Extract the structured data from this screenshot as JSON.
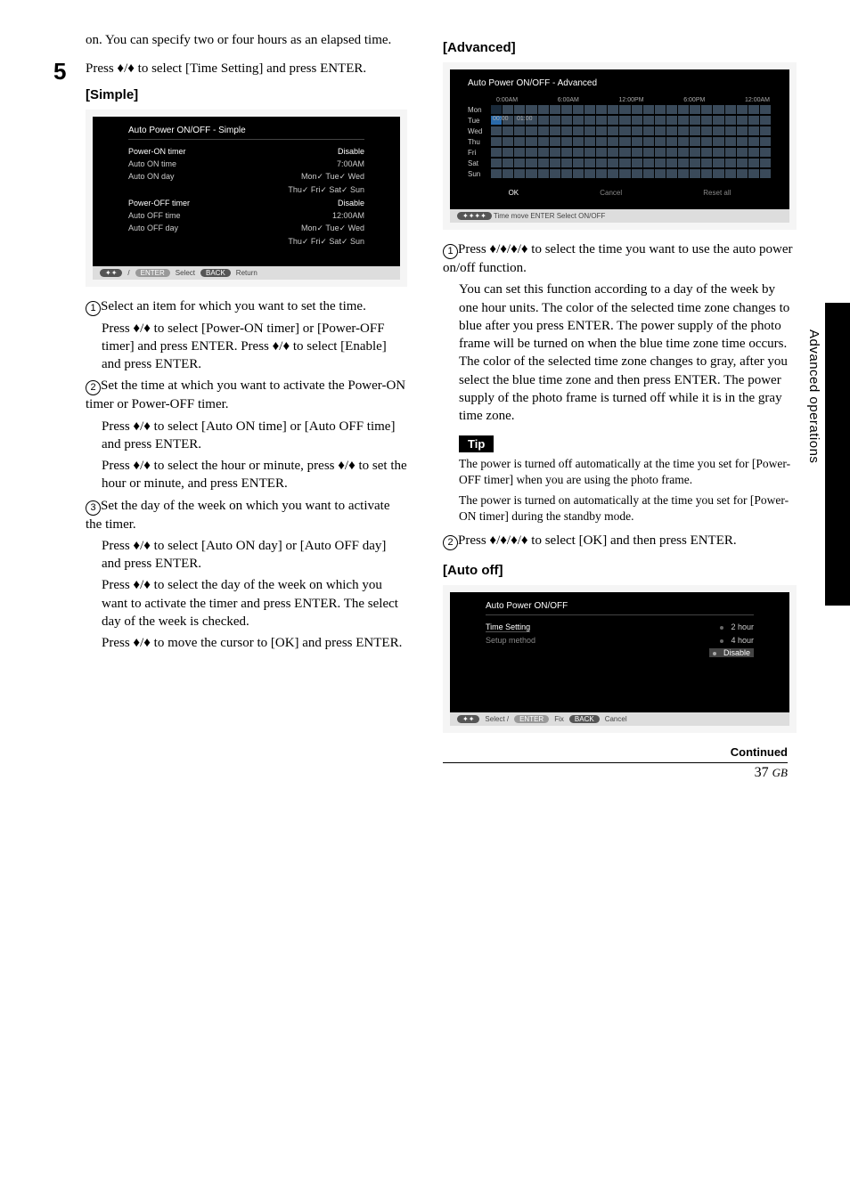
{
  "side_tab_label": "Advanced operations",
  "intro_text": "on. You can specify two or four hours as an elapsed time.",
  "step5": {
    "num": "5",
    "text": "Press ♦/♦ to select [Time Setting] and press ENTER."
  },
  "simple": {
    "heading": "[Simple]",
    "osd_title": "Auto Power ON/OFF - Simple",
    "rows": [
      {
        "l": "Power-ON timer",
        "r": "Disable",
        "white": true
      },
      {
        "l": "Auto ON time",
        "r": "7:00AM"
      },
      {
        "l": "Auto ON day",
        "r": "Mon✓ Tue✓ Wed"
      },
      {
        "l": "",
        "r": "Thu✓   Fri✓   Sat✓  Sun"
      },
      {
        "l": "Power-OFF timer",
        "r": "Disable",
        "white": true
      },
      {
        "l": "Auto OFF time",
        "r": "12:00AM"
      },
      {
        "l": "Auto OFF day",
        "r": "Mon✓ Tue✓ Wed"
      },
      {
        "l": "",
        "r": "Thu✓   Fri✓   Sat✓  Sun"
      }
    ],
    "footer": [
      "ENTER",
      "Select",
      "BACK",
      "Return"
    ],
    "step1_a": "Select an item for which you want to set the time.",
    "step1_b": "Press ♦/♦ to select [Power-ON timer] or [Power-OFF timer] and press ENTER. Press ♦/♦ to select [Enable] and press ENTER.",
    "step2_a": "Set the time at which you want to activate the Power-ON timer or Power-OFF timer.",
    "step2_b": "Press ♦/♦ to select [Auto ON time] or [Auto OFF time] and press ENTER.",
    "step2_c": "Press ♦/♦ to select the hour or minute, press ♦/♦ to set the hour or minute, and press ENTER.",
    "step3_a": "Set the day of the week on which you want to activate the timer.",
    "step3_b": "Press ♦/♦ to select [Auto ON day] or [Auto OFF day] and press ENTER.",
    "step3_c": "Press ♦/♦ to select the day of the week on which you want to activate the timer and press ENTER. The select day of the week is checked.",
    "step3_d": "Press ♦/♦ to move the cursor to [OK] and press ENTER."
  },
  "advanced": {
    "heading": "[Advanced]",
    "osd_title": "Auto Power ON/OFF - Advanced",
    "axis": [
      "0:00AM",
      "6:00AM",
      "12:00PM",
      "6:00PM",
      "12:00AM"
    ],
    "days": [
      "Mon",
      "Tue",
      "Wed",
      "Thu",
      "Fri",
      "Sat",
      "Sun"
    ],
    "tu_times": [
      "00:00",
      "01:00"
    ],
    "buttons": [
      "OK",
      "Cancel",
      "Reset all"
    ],
    "footer": "Time move  ENTER  Select ON/OFF",
    "step1_a": "Press ♦/♦/♦/♦ to select the time you want to use the auto power on/off function.",
    "step1_b": "You can set this function according to a day of the week by one hour units. The color of the selected time zone changes to blue after you press ENTER. The power supply of the photo frame will be turned on when the blue time zone time occurs. The color of the selected time zone changes to gray, after you select the blue time zone and then press ENTER. The power supply of the photo frame is turned off while it is in the gray time zone.",
    "tip_label": "Tip",
    "tip_text1": "The power is turned off automatically at the time you set for [Power-OFF timer] when you are using the photo frame.",
    "tip_text2": "The power is turned on automatically at the time you set for [Power-ON timer] during the standby mode.",
    "step2": "Press ♦/♦/♦/♦ to select [OK] and then press ENTER."
  },
  "autooff": {
    "heading": "[Auto off]",
    "osd_title": "Auto Power ON/OFF",
    "left": [
      "Time Setting",
      "Setup method"
    ],
    "right": [
      "2 hour",
      "4 hour",
      "Disable"
    ],
    "footer": [
      "Select /",
      "ENTER",
      "Fix",
      "BACK",
      "Cancel"
    ]
  },
  "footer": {
    "continued": "Continued",
    "page": "37",
    "region": "GB"
  }
}
